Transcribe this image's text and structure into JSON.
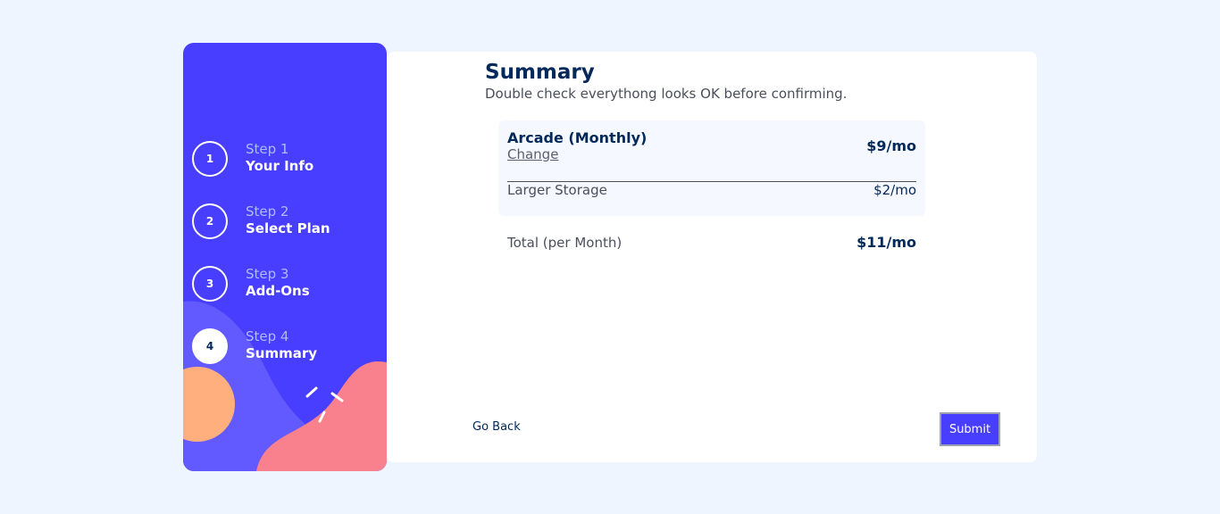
{
  "steps": [
    {
      "number": "1",
      "step_label": "Step 1",
      "title": "Your Info",
      "active": false
    },
    {
      "number": "2",
      "step_label": "Step 2",
      "title": "Select Plan",
      "active": false
    },
    {
      "number": "3",
      "step_label": "Step 3",
      "title": "Add-Ons",
      "active": false
    },
    {
      "number": "4",
      "step_label": "Step 4",
      "title": "Summary",
      "active": true
    }
  ],
  "summary": {
    "title": "Summary",
    "subtitle": "Double check everythong looks OK before confirming.",
    "plan_name": "Arcade (Monthly)",
    "change_label": "Change",
    "plan_price": "$9/mo",
    "addons": [
      {
        "name": "Larger Storage",
        "price": "$2/mo"
      }
    ],
    "total_label": "Total (per Month)",
    "total_price": "$11/mo"
  },
  "actions": {
    "back_label": "Go Back",
    "submit_label": "Submit"
  },
  "colors": {
    "sidebar": "#483eff",
    "accent_orange": "#ffaf7e",
    "accent_pink": "#f9818e",
    "accent_purple": "#6259ff",
    "page_bg": "#eef5ff"
  }
}
